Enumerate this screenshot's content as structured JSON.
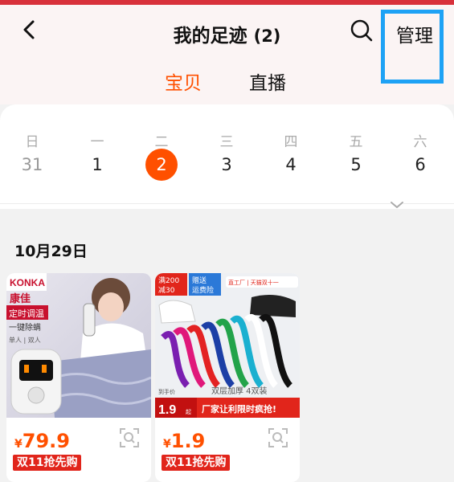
{
  "header": {
    "title": "我的足迹",
    "count": "(2)",
    "manage_label": "管理"
  },
  "tabs": [
    {
      "label": "宝贝",
      "active": true
    },
    {
      "label": "直播",
      "active": false
    }
  ],
  "calendar": {
    "weekdays": [
      "日",
      "一",
      "二",
      "三",
      "四",
      "五",
      "六"
    ],
    "dates": [
      "31",
      "1",
      "2",
      "3",
      "4",
      "5",
      "6"
    ],
    "selected": "2"
  },
  "section": {
    "date": "10月29日"
  },
  "products": [
    {
      "currency": "¥",
      "price": "79.9",
      "tag": "双11抢先购",
      "image_text": {
        "brand_en": "KONKA",
        "brand_cn": "康佳",
        "badge": "定时调温",
        "feature": "一键除螨",
        "modes": "单人 | 双人"
      }
    },
    {
      "currency": "¥",
      "price": "1.9",
      "tag": "双11抢先购",
      "image_text": {
        "promo1_line1": "满200",
        "promo1_line2": "减30",
        "promo2_line1": "赠送",
        "promo2_line2": "运费险",
        "store": "直工厂 | 天猫双十一",
        "desc": "双层加厚 4双装",
        "hand_label": "到手价",
        "hand_price": "1.9",
        "hand_suffix": "起",
        "slogan": "厂家让利限时疯抢!"
      }
    }
  ],
  "colors": {
    "accent": "#ff5000",
    "tag_red": "#e1251b",
    "highlight_box": "#1ea2f5"
  }
}
